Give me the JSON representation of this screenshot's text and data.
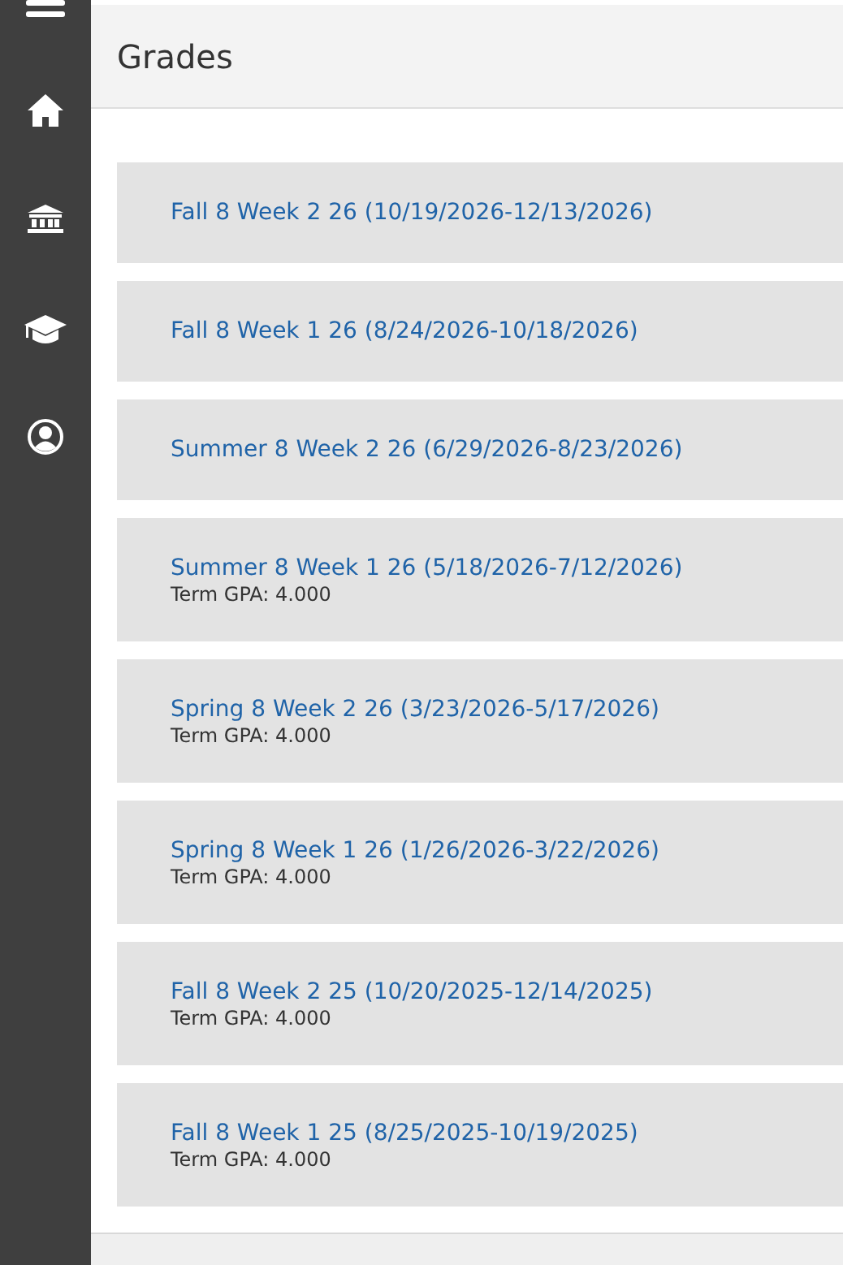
{
  "sidebar": {
    "items": [
      {
        "kind": "menu"
      },
      {
        "kind": "home"
      },
      {
        "kind": "bank"
      },
      {
        "kind": "cap"
      },
      {
        "kind": "user"
      }
    ]
  },
  "header": {
    "title": "Grades"
  },
  "terms": [
    {
      "name": "Fall 8 Week 2 26 (10/19/2026-12/13/2026)"
    },
    {
      "name": "Fall 8 Week 1 26 (8/24/2026-10/18/2026)"
    },
    {
      "name": "Summer 8 Week 2 26 (6/29/2026-8/23/2026)"
    },
    {
      "name": "Summer 8 Week 1 26 (5/18/2026-7/12/2026)",
      "gpa": "Term GPA: 4.000"
    },
    {
      "name": "Spring 8 Week 2 26 (3/23/2026-5/17/2026)",
      "gpa": "Term GPA: 4.000"
    },
    {
      "name": "Spring 8 Week 1 26 (1/26/2026-3/22/2026)",
      "gpa": "Term GPA: 4.000"
    },
    {
      "name": "Fall 8 Week 2 25 (10/20/2025-12/14/2025)",
      "gpa": "Term GPA: 4.000"
    },
    {
      "name": "Fall 8 Week 1 25 (8/25/2025-10/19/2025)",
      "gpa": "Term GPA: 4.000"
    }
  ]
}
